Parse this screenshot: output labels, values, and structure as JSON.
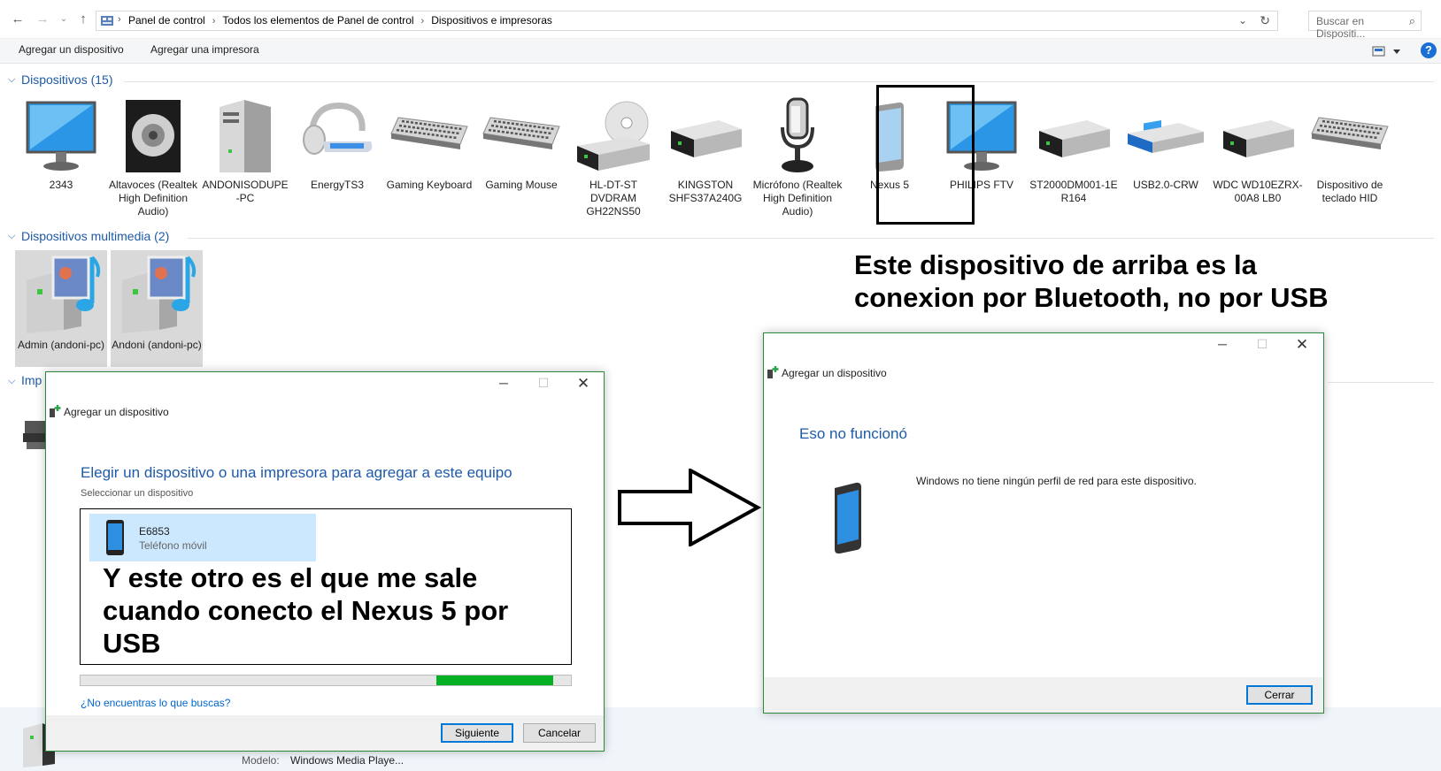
{
  "address": {
    "crumbs": [
      "Panel de control",
      "Todos los elementos de Panel de control",
      "Dispositivos e impresoras"
    ],
    "search_placeholder": "Buscar en Dispositi..."
  },
  "commands": {
    "add_device": "Agregar un dispositivo",
    "add_printer": "Agregar una impresora"
  },
  "groups": {
    "devices": "Dispositivos (15)",
    "multimedia": "Dispositivos multimedia (2)",
    "printers_partial": "Imp"
  },
  "devices": [
    {
      "label": "2343",
      "icon": "monitor-icon"
    },
    {
      "label": "Altavoces (Realtek High Definition Audio)",
      "icon": "speaker-icon"
    },
    {
      "label": "ANDONISODUPE -PC",
      "icon": "computer-tower-icon"
    },
    {
      "label": "EnergyTS3",
      "icon": "headset-icon"
    },
    {
      "label": "Gaming Keyboard",
      "icon": "keyboard-icon"
    },
    {
      "label": "Gaming Mouse",
      "icon": "keyboard-icon"
    },
    {
      "label": "HL-DT-ST DVDRAM GH22NS50",
      "icon": "dvd-drive-icon"
    },
    {
      "label": "KINGSTON SHFS37A240G",
      "icon": "drive-icon"
    },
    {
      "label": "Micrófono (Realtek High Definition Audio)",
      "icon": "microphone-icon"
    },
    {
      "label": "Nexus 5",
      "icon": "phone-icon"
    },
    {
      "label": "PHILIPS FTV",
      "icon": "monitor-icon"
    },
    {
      "label": "ST2000DM001-1E R164",
      "icon": "drive-icon"
    },
    {
      "label": "USB2.0-CRW",
      "icon": "card-reader-icon"
    },
    {
      "label": "WDC WD10EZRX-00A8 LB0",
      "icon": "drive-icon"
    },
    {
      "label": "Dispositivo de teclado HID",
      "icon": "keyboard-icon"
    }
  ],
  "multimedia": [
    {
      "label": "Admin (andoni-pc)",
      "icon": "media-server-icon"
    },
    {
      "label": "Andoni (andoni-pc)",
      "icon": "media-server-icon"
    }
  ],
  "notes": {
    "top": "Este dispositivo de arriba es la conexion por Bluetooth, no por USB",
    "list": "Y este otro es el que me sale cuando conecto el Nexus 5 por USB"
  },
  "dialog_left": {
    "title": "Agregar un dispositivo",
    "heading": "Elegir un dispositivo o una impresora para agregar a este equipo",
    "subheading": "Seleccionar un dispositivo",
    "device_name": "E6853",
    "device_type": "Teléfono móvil",
    "progress": 0.25,
    "link": "¿No encuentras lo que buscas?",
    "next": "Siguiente",
    "cancel": "Cancelar"
  },
  "dialog_right": {
    "title": "Agregar un dispositivo",
    "heading": "Eso no funcionó",
    "message": "Windows no tiene ningún perfil de red para este dispositivo.",
    "close": "Cerrar"
  },
  "details": {
    "model_label": "Modelo:",
    "model_value": "Windows Media Playe..."
  },
  "colors": {
    "accent": "#1e5aa8",
    "selection": "#cce8ff",
    "progress": "#06b025",
    "dialog_border": "#2a8a3a"
  }
}
